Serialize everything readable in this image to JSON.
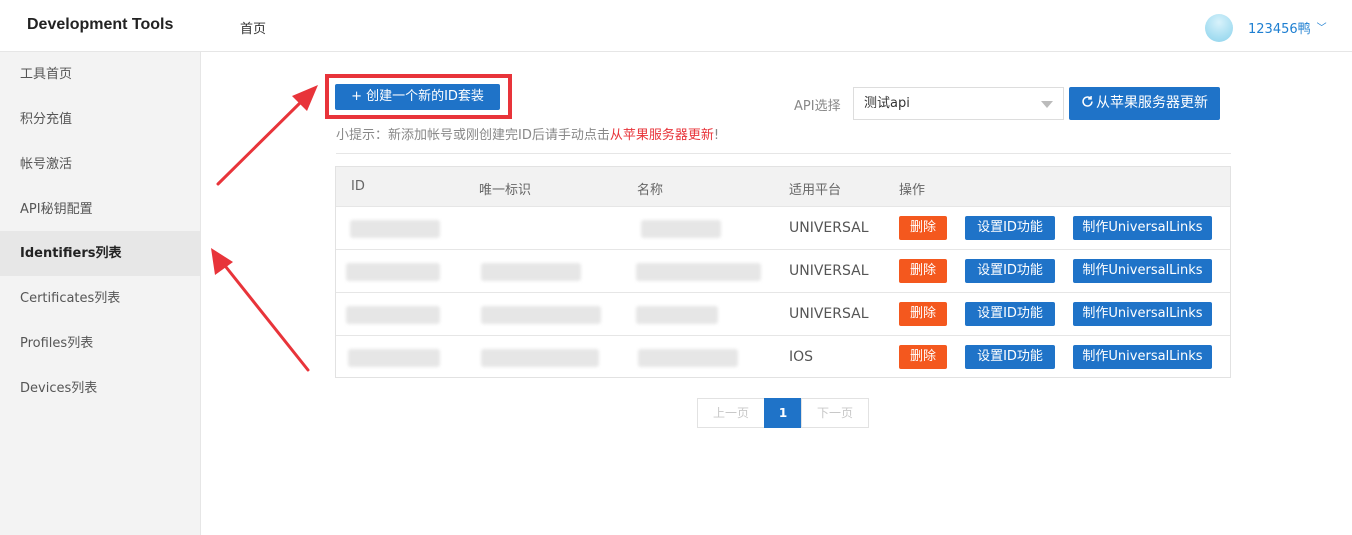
{
  "header": {
    "app_title": "Development Tools",
    "nav_home": "首页",
    "user_name": "123456鸭",
    "user_chevron": "﹀"
  },
  "sidebar": {
    "items": [
      {
        "label": "工具首页"
      },
      {
        "label": "积分充值"
      },
      {
        "label": "帐号激活"
      },
      {
        "label": "API秘钥配置"
      },
      {
        "label": "Identifiers列表",
        "active": true
      },
      {
        "label": "Certificates列表"
      },
      {
        "label": "Profiles列表"
      },
      {
        "label": "Devices列表"
      }
    ]
  },
  "toolbar": {
    "create_label": "+ 创建一个新的ID套装",
    "hint_prefix": "小提示：新添加帐号或刚创建完ID后请手动点击",
    "hint_link": "从苹果服务器更新",
    "hint_suffix": "!",
    "api_label": "API选择",
    "api_selected": "测试api",
    "refresh_label": "从苹果服务器更新",
    "refresh_icon": "refresh-icon"
  },
  "table": {
    "columns": [
      "ID",
      "唯一标识",
      "名称",
      "适用平台",
      "操作"
    ],
    "rows": [
      {
        "platform": "UNIVERSAL"
      },
      {
        "platform": "UNIVERSAL"
      },
      {
        "platform": "UNIVERSAL"
      },
      {
        "platform": "IOS"
      }
    ],
    "actions": {
      "delete": "删除",
      "set_id": "设置ID功能",
      "universal_links": "制作UniversalLinks"
    }
  },
  "pagination": {
    "prev": "上一页",
    "current": "1",
    "next": "下一页"
  },
  "colors": {
    "primary": "#1f73c8",
    "danger": "#f4581e",
    "annotation": "#e8343a"
  }
}
